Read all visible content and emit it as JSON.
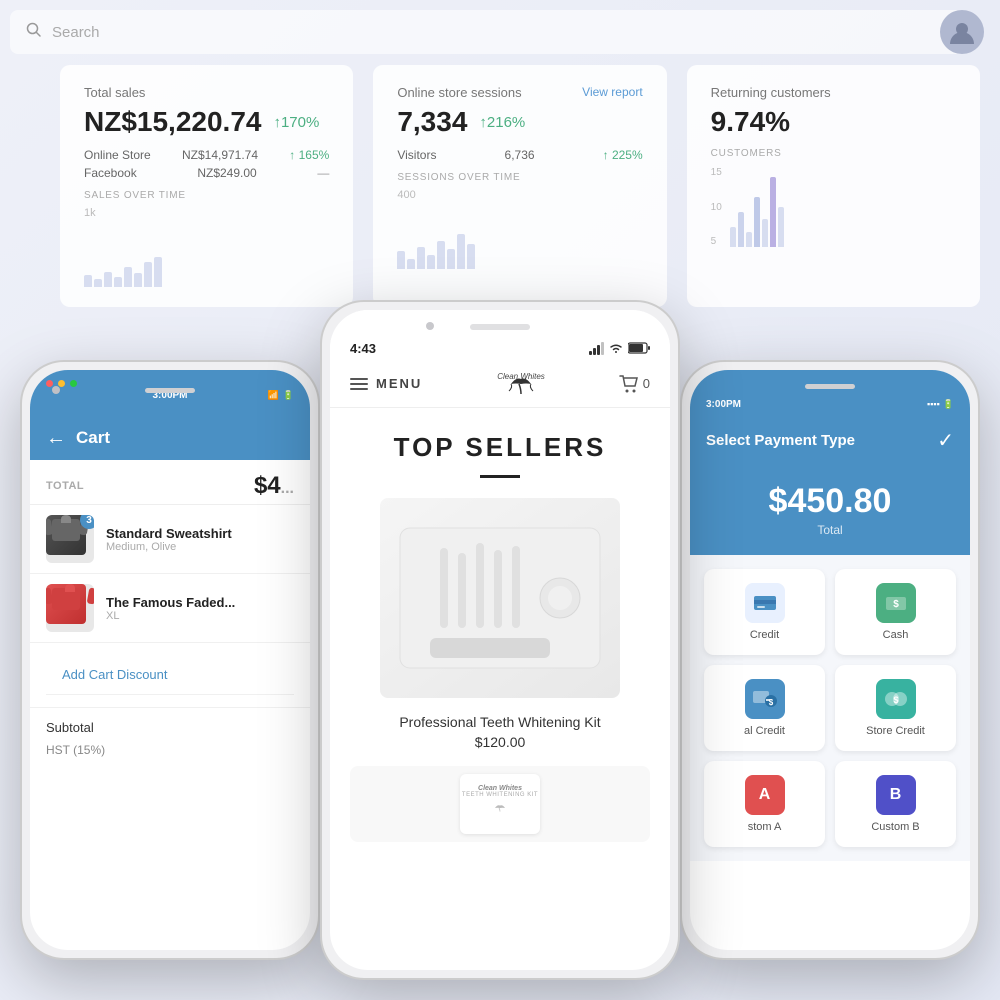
{
  "dashboard": {
    "search_placeholder": "Search"
  },
  "stats": {
    "total_sales": {
      "label": "Total sales",
      "value": "NZ$15,220.74",
      "change": "↑170%",
      "online_store_label": "Online Store",
      "online_store_value": "NZ$14,971.74",
      "online_store_change": "↑ 165%",
      "facebook_label": "Facebook",
      "facebook_value": "NZ$249.00",
      "facebook_change": "—",
      "section_label": "SALES OVER TIME",
      "chart_y": "1k"
    },
    "online_sessions": {
      "label": "Online store sessions",
      "value": "7,334",
      "change": "↑216%",
      "view_report": "View report",
      "visitors_label": "Visitors",
      "visitors_value": "6,736",
      "visitors_change": "↑ 225%",
      "section_label": "SESSIONS OVER TIME",
      "chart_y": "400"
    },
    "returning_customers": {
      "label": "Returning customers",
      "value": "9.74%",
      "customers_label": "CUSTOMERS",
      "y_15": "15",
      "y_10": "10",
      "y_5": "5"
    }
  },
  "phones": {
    "left": {
      "status_time": "3:00PM",
      "header_title": "Cart",
      "total_label": "TOTAL",
      "total_value": "$4",
      "item1_name": "Standard Sweatshirt",
      "item1_sub": "Medium, Olive",
      "item1_badge": "3",
      "item2_name": "The Famous Faded...",
      "item2_sub": "XL",
      "add_discount": "Add Cart Discount",
      "subtotal_label": "Subtotal",
      "hst_label": "HST (15%)"
    },
    "center": {
      "status_time": "4:43",
      "menu_label": "MENU",
      "cart_count": "0",
      "page_title": "TOP SELLERS",
      "product1_name": "Professional Teeth Whitening Kit",
      "product1_price": "$120.00",
      "logo_text": "Clean Whites"
    },
    "right": {
      "status_time": "3:00PM",
      "header_title": "Select Payment Type",
      "amount": "$450.80",
      "amount_label": "Total",
      "btn1_label": "Credit",
      "btn2_label": "Cash",
      "btn3_label": "al Credit",
      "btn4_label": "Store Credit",
      "btn5_label": "stom A",
      "btn6_label": "Custom B"
    }
  }
}
